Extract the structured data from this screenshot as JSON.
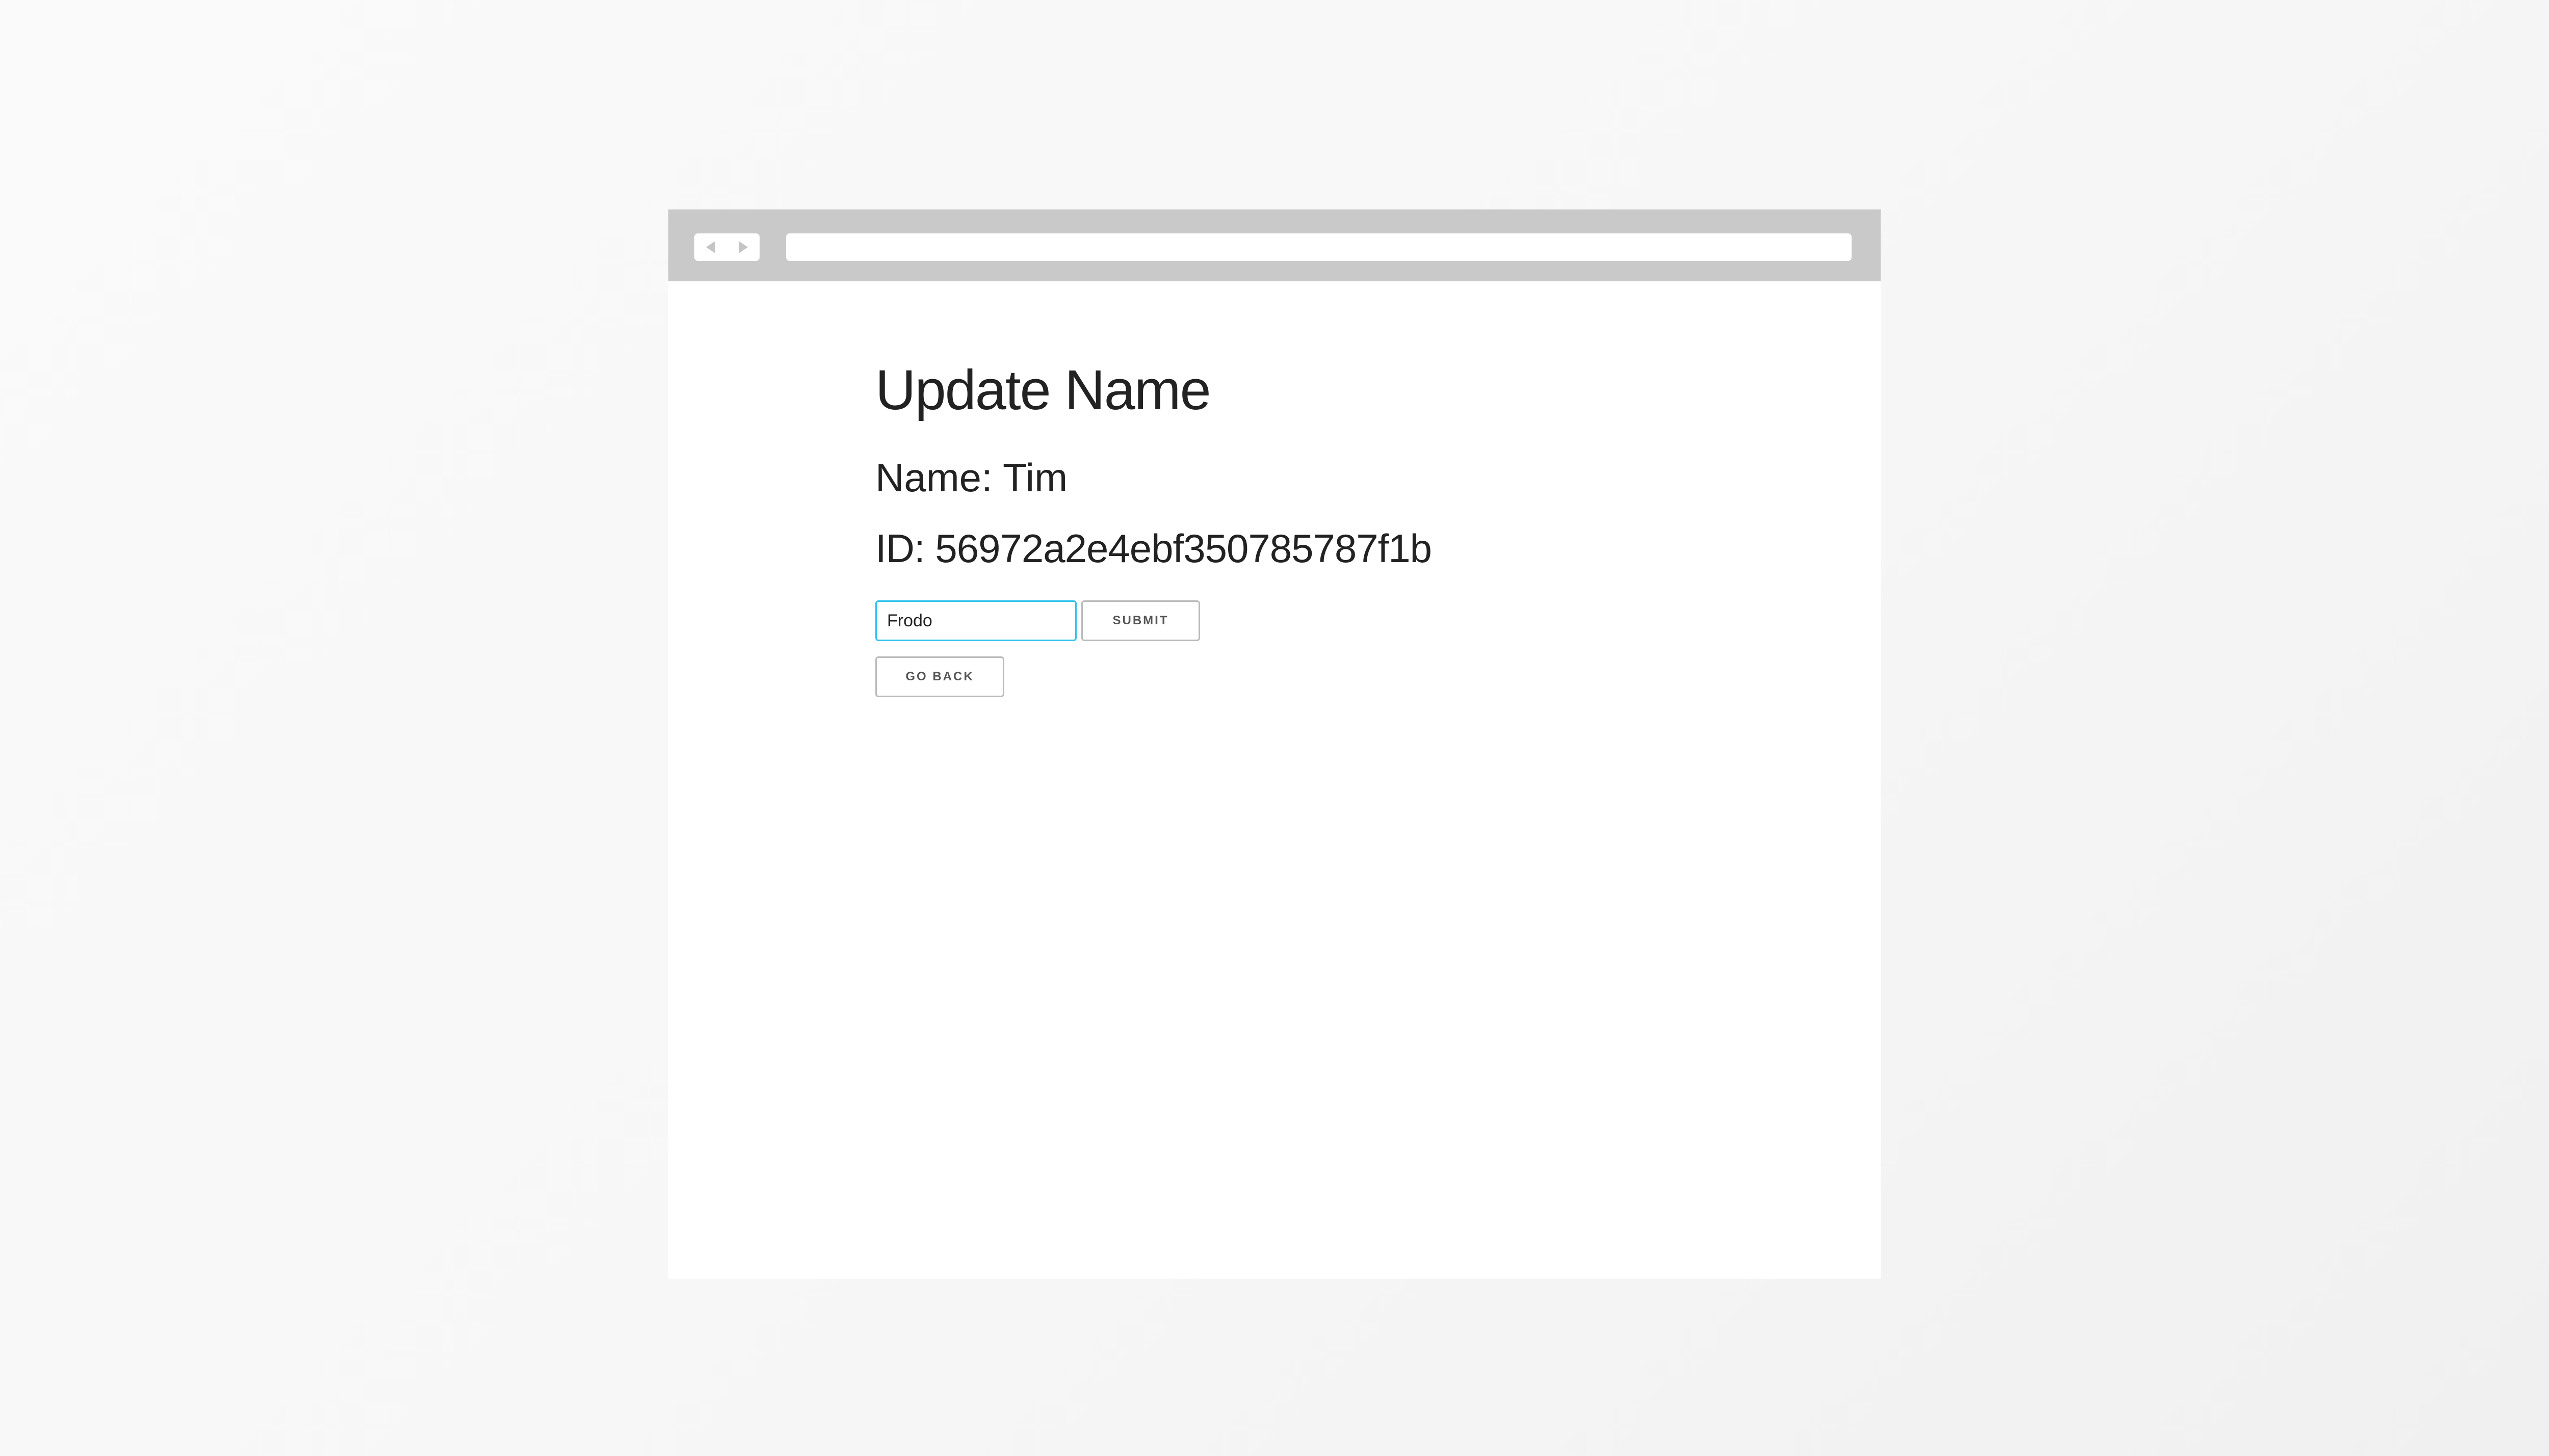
{
  "colors": {
    "page_background": "#f7f7f7",
    "toolbar": "#c9c9c9",
    "input_focus_border": "#33c3f0",
    "button_border": "#bbbbbb",
    "text": "#222222"
  },
  "browser": {
    "back_icon": "triangle-left-icon",
    "forward_icon": "triangle-right-icon",
    "address": ""
  },
  "page": {
    "title": "Update Name",
    "name_line": "Name: Tim",
    "id_line": "ID: 56972a2e4ebf350785787f1b"
  },
  "form": {
    "name_input_value": "Frodo",
    "submit_label": "SUBMIT",
    "go_back_label": "GO BACK"
  }
}
